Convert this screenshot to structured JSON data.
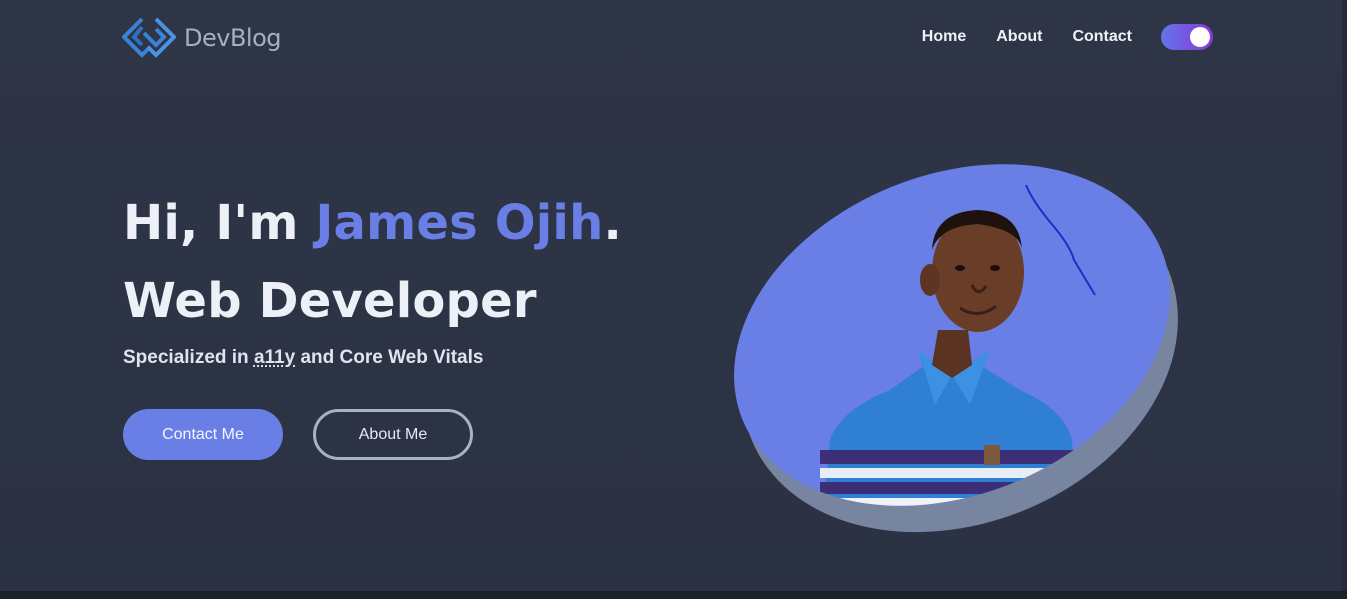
{
  "brand": {
    "name": "DevBlog",
    "logo_icon": "diamond-chain-logo-icon"
  },
  "nav": {
    "items": [
      {
        "label": "Home"
      },
      {
        "label": "About"
      },
      {
        "label": "Contact"
      }
    ],
    "theme_toggle": {
      "icon": "theme-toggle",
      "state": "on"
    }
  },
  "hero": {
    "greeting": "Hi, I'm ",
    "name": "James Ojih",
    "period": ".",
    "role": "Web Developer",
    "subtitle_prefix": "Specialized in ",
    "subtitle_abbr": "a11y",
    "subtitle_suffix": " and Core Web Vitals",
    "primary_button": "Contact Me",
    "secondary_button": "About Me"
  },
  "colors": {
    "background": "#2d3446",
    "accent": "#6a7fe6",
    "accent_shadow": "#7785a0",
    "text": "#edf0f7"
  }
}
